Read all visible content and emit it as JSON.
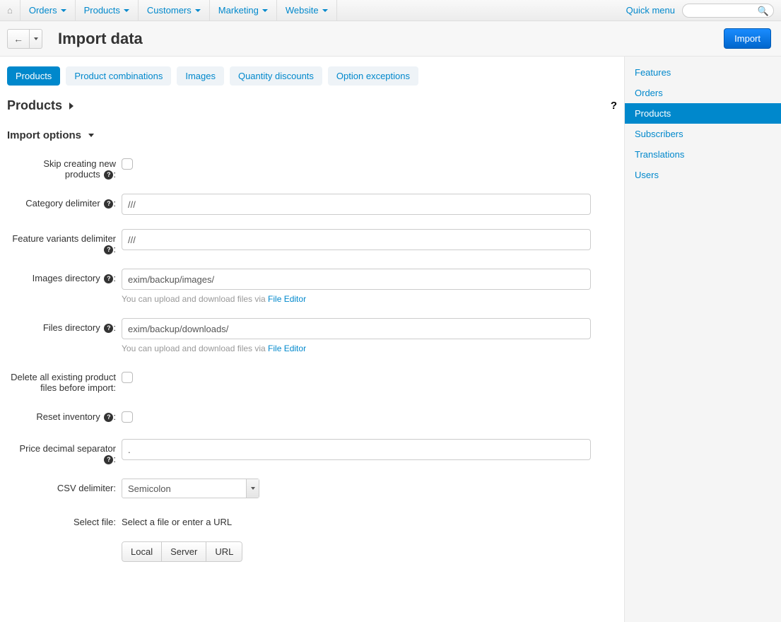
{
  "topnav": {
    "items": [
      "Orders",
      "Products",
      "Customers",
      "Marketing",
      "Website"
    ],
    "quick": "Quick menu"
  },
  "header": {
    "title": "Import data",
    "import_btn": "Import"
  },
  "tabs": [
    "Products",
    "Product combinations",
    "Images",
    "Quantity discounts",
    "Option exceptions"
  ],
  "section": {
    "title": "Products"
  },
  "subsection": "Import options",
  "form": {
    "skip_label": "Skip creating new products",
    "cat_delim_label": "Category delimiter",
    "cat_delim_value": "///",
    "feat_delim_label": "Feature variants delimiter",
    "feat_delim_value": "///",
    "images_dir_label": "Images directory",
    "images_dir_value": "exim/backup/images/",
    "files_dir_label": "Files directory",
    "files_dir_value": "exim/backup/downloads/",
    "hint_prefix": "You can upload and download files via ",
    "hint_link": "File Editor",
    "delete_files_label": "Delete all existing product files before import:",
    "reset_inv_label": "Reset inventory",
    "price_sep_label": "Price decimal separator",
    "price_sep_value": ".",
    "csv_delim_label": "CSV delimiter:",
    "csv_delim_value": "Semicolon",
    "select_file_label": "Select file:",
    "select_file_text": "Select a file or enter a URL",
    "btn_local": "Local",
    "btn_server": "Server",
    "btn_url": "URL"
  },
  "sidebar": [
    "Features",
    "Orders",
    "Products",
    "Subscribers",
    "Translations",
    "Users"
  ],
  "sidebar_active": 2
}
